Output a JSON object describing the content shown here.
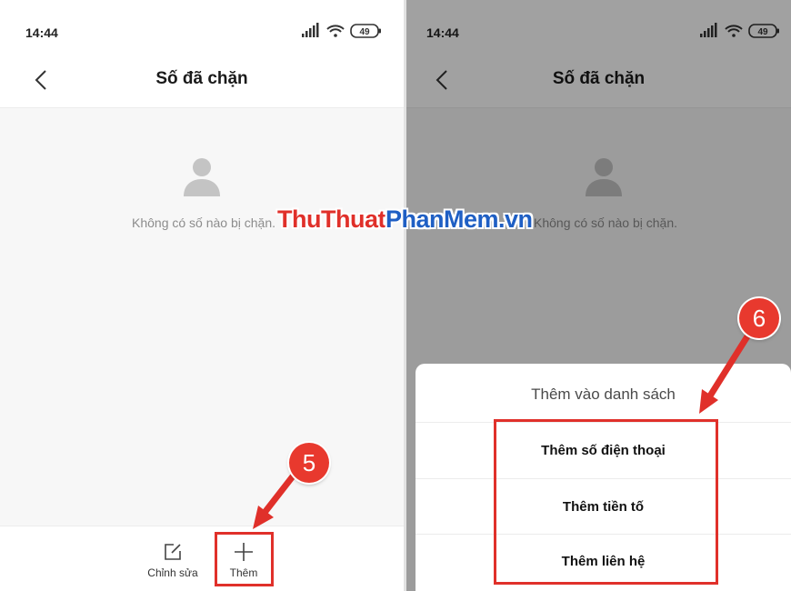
{
  "left_screen": {
    "status_time": "14:44",
    "battery": "49",
    "title": "Số đã chặn",
    "empty_text": "Không có số nào bị chặn.",
    "toolbar": {
      "edit_label": "Chỉnh sửa",
      "add_label": "Thêm"
    }
  },
  "right_screen": {
    "status_time": "14:44",
    "battery": "49",
    "title": "Số đã chặn",
    "empty_text": "Không có số nào bị chặn.",
    "sheet": {
      "title": "Thêm vào danh sách",
      "options": [
        "Thêm số điện thoại",
        "Thêm tiền tố",
        "Thêm liên hệ"
      ]
    }
  },
  "annotations": {
    "step_5": "5",
    "step_6": "6"
  },
  "watermark": {
    "part1": "ThuThuat",
    "part2": "PhanMem.vn"
  },
  "icons": [
    "back-icon",
    "person-icon",
    "edit-icon",
    "plus-icon",
    "signal-icon",
    "wifi-icon",
    "battery-icon"
  ],
  "colors": {
    "highlight": "#e0302a",
    "watermark_red": "#e0302a",
    "watermark_blue": "#1f5fc4"
  }
}
